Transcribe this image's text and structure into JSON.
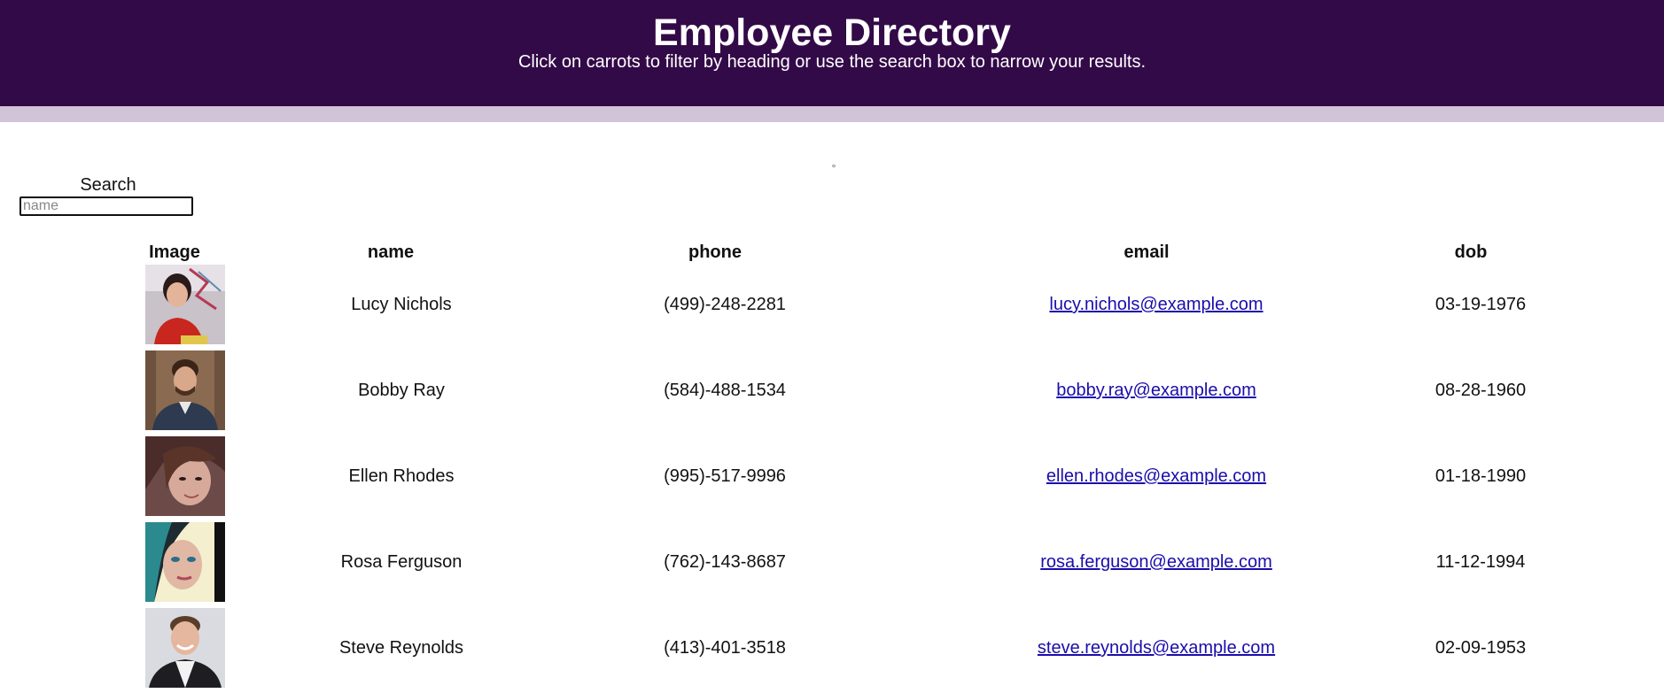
{
  "header": {
    "title": "Employee Directory",
    "subtitle": "Click on carrots to filter by heading or use the search box to narrow your results."
  },
  "center_mark": "°",
  "search": {
    "label": "Search",
    "placeholder": "name",
    "value": ""
  },
  "columns": {
    "image": "Image",
    "name": "name",
    "phone": "phone",
    "email": "email",
    "dob": "dob"
  },
  "colors": {
    "header_bg": "#330a48",
    "accent_bar": "#d1c4d9",
    "link": "#1a0dab"
  },
  "employees": [
    {
      "name": "Lucy Nichols",
      "phone": "(499)-248-2281",
      "email": "lucy.nichols@example.com",
      "dob": "03-19-1976",
      "avatar": "woman-photo"
    },
    {
      "name": "Bobby Ray",
      "phone": "(584)-488-1534",
      "email": "bobby.ray@example.com",
      "dob": "08-28-1960",
      "avatar": "man-photo"
    },
    {
      "name": "Ellen Rhodes",
      "phone": "(995)-517-9996",
      "email": "ellen.rhodes@example.com",
      "dob": "01-18-1990",
      "avatar": "woman-photo"
    },
    {
      "name": "Rosa Ferguson",
      "phone": "(762)-143-8687",
      "email": "rosa.ferguson@example.com",
      "dob": "11-12-1994",
      "avatar": "woman-photo"
    },
    {
      "name": "Steve Reynolds",
      "phone": "(413)-401-3518",
      "email": "steve.reynolds@example.com",
      "dob": "02-09-1953",
      "avatar": "man-photo"
    }
  ]
}
